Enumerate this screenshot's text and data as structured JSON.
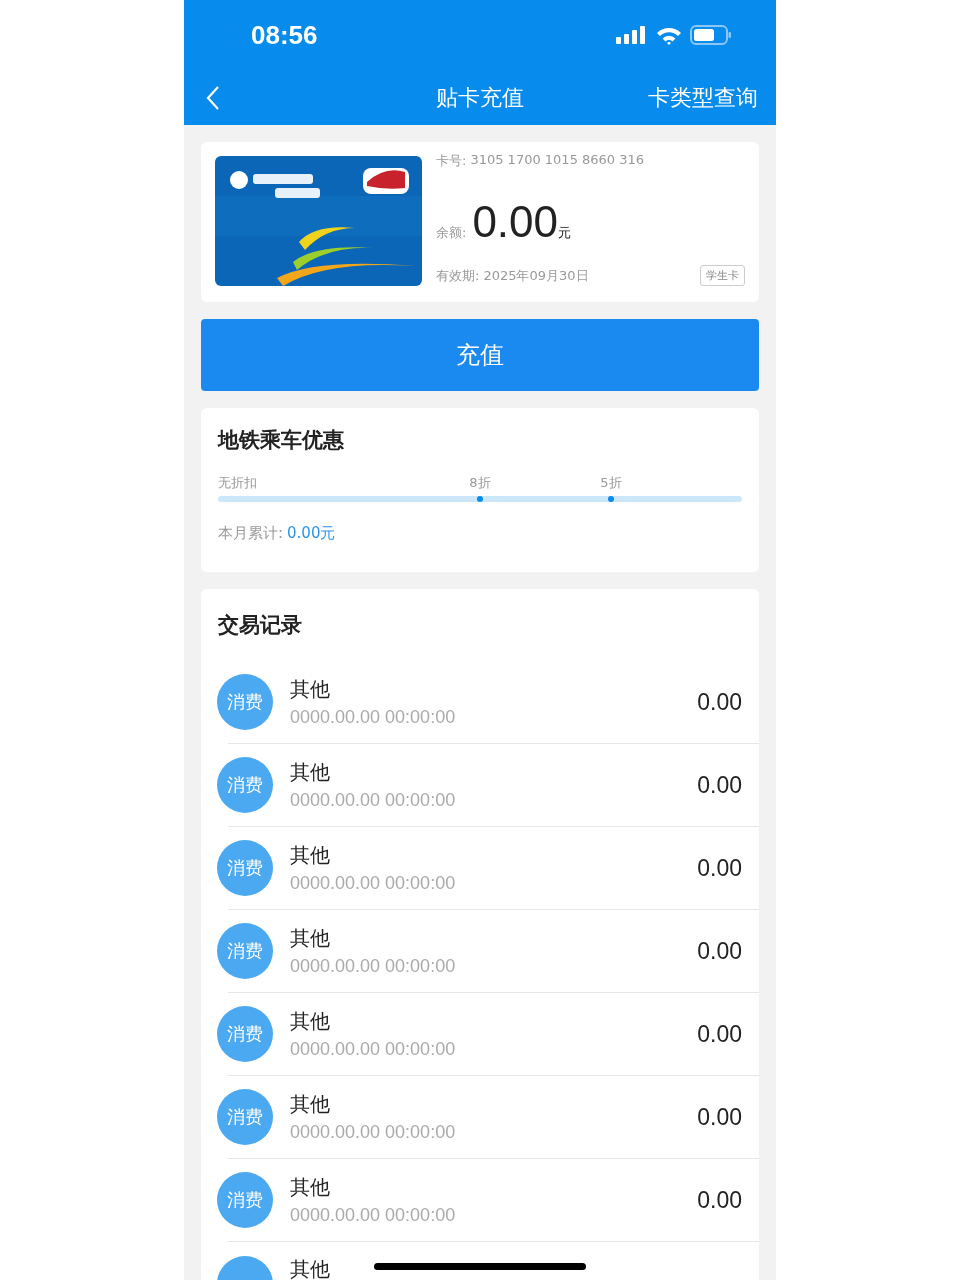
{
  "status_bar": {
    "time": "08:56"
  },
  "nav": {
    "title": "贴卡充值",
    "action": "卡类型查询"
  },
  "card": {
    "number_label": "卡号:",
    "number": "3105 1700 1015 8660 316",
    "balance_label": "余额:",
    "balance": "0.00",
    "balance_unit": "元",
    "expiry_label": "有效期:",
    "expiry": "2025年09月30日",
    "type_tag": "学生卡"
  },
  "recharge_button": "充值",
  "discount": {
    "title": "地铁乘车优惠",
    "marks": [
      {
        "label": "无折扣"
      },
      {
        "label": "8折"
      },
      {
        "label": "5折"
      }
    ],
    "total_label": "本月累计:",
    "total": "0.00元"
  },
  "transactions": {
    "title": "交易记录",
    "rows": [
      {
        "kind": "full",
        "badge": "消费",
        "name": "其他",
        "time": "0000.00.00 00:00:00",
        "amount": "0.00"
      },
      {
        "kind": "full",
        "badge": "消费",
        "name": "其他",
        "time": "0000.00.00 00:00:00",
        "amount": "0.00"
      },
      {
        "kind": "full",
        "badge": "消费",
        "name": "其他",
        "time": "0000.00.00 00:00:00",
        "amount": "0.00"
      },
      {
        "kind": "full",
        "badge": "消费",
        "name": "其他",
        "time": "0000.00.00 00:00:00",
        "amount": "0.00"
      },
      {
        "kind": "full",
        "badge": "消费",
        "name": "其他",
        "time": "0000.00.00 00:00:00",
        "amount": "0.00"
      },
      {
        "kind": "full",
        "badge": "消费",
        "name": "其他",
        "time": "0000.00.00 00:00:00",
        "amount": "0.00"
      },
      {
        "kind": "full",
        "badge": "消费",
        "name": "其他",
        "time": "0000.00.00 00:00:00",
        "amount": "0.00"
      },
      {
        "kind": "cut",
        "name": "其他"
      }
    ]
  }
}
